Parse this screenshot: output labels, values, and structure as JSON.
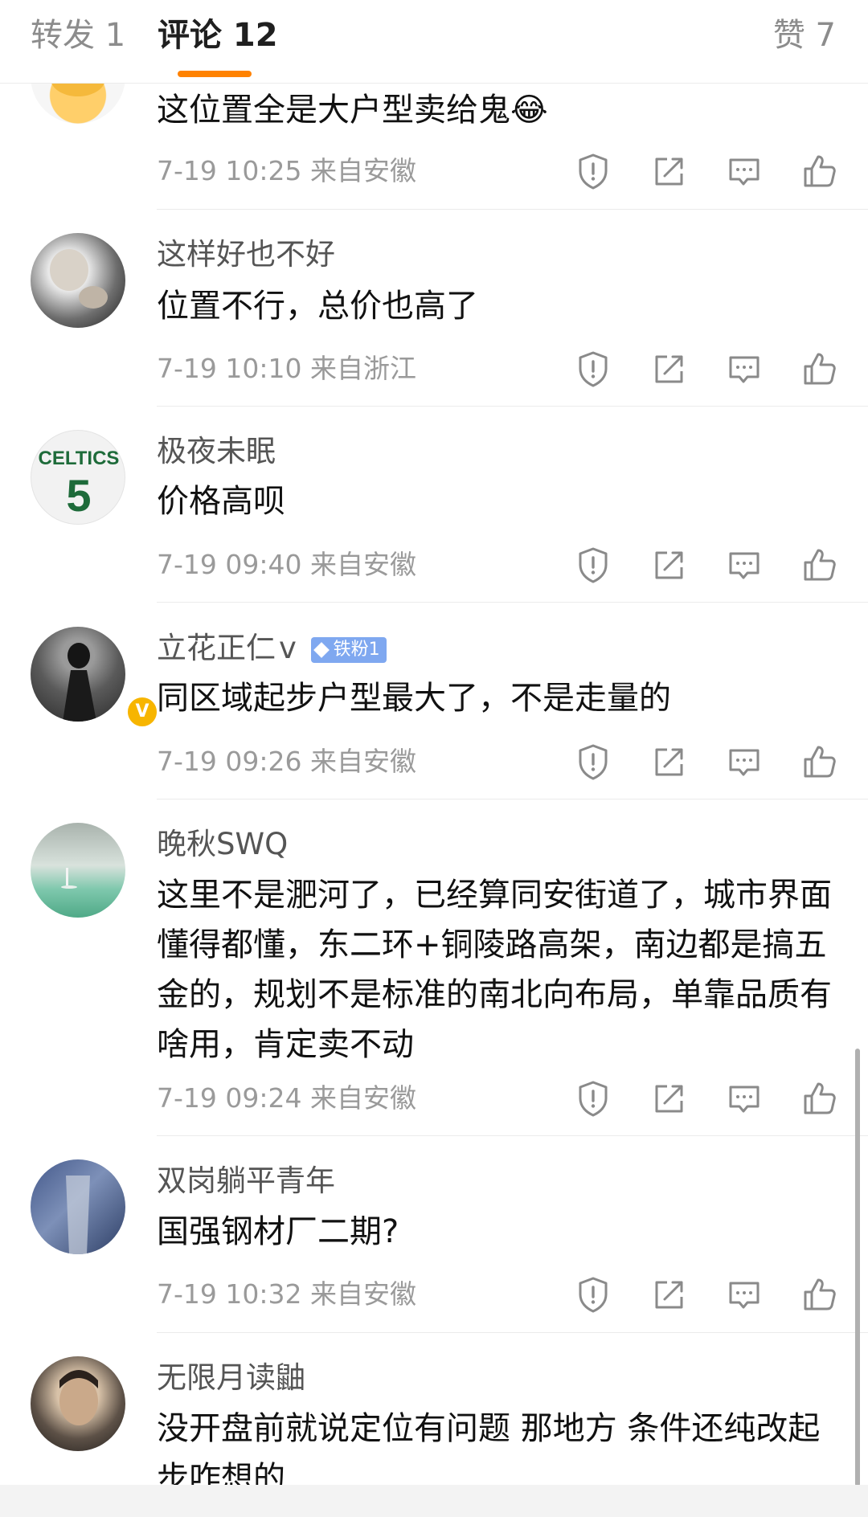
{
  "tabs": {
    "repost": "转发 1",
    "comments": "评论 12",
    "likes": "赞 7",
    "accent": "#ff8200"
  },
  "comments": [
    {
      "name": "",
      "text": "这位置全是大户型卖给鬼",
      "emoji": "😂",
      "meta": "7-19 10:25  来自安徽"
    },
    {
      "name": "这样好也不好",
      "text": "位置不行，总价也高了",
      "meta": "7-19 10:10  来自浙江"
    },
    {
      "name": "极夜未眠",
      "text": "价格高呗",
      "meta": "7-19 09:40  来自安徽",
      "avatar_text": "CELTICS",
      "avatar_number": "5"
    },
    {
      "name": "立花正仁",
      "name_suffix": "v",
      "fan_badge": "铁粉1",
      "verified": "V",
      "text": "同区域起步户型最大了，不是走量的",
      "meta": "7-19 09:26  来自安徽"
    },
    {
      "name": "晚秋SWQ",
      "text": "这里不是淝河了，已经算同安街道了，城市界面懂得都懂，东二环+铜陵路高架，南边都是搞五金的，规划不是标准的南北向布局，单靠品质有啥用，肯定卖不动",
      "meta": "7-19 09:24  来自安徽"
    },
    {
      "name": "双岗躺平青年",
      "text": "国强钢材厂二期?",
      "meta": "7-19 10:32  来自安徽"
    },
    {
      "name": "无限月读鼬",
      "text": "没开盘前就说定位有问题 那地方 条件还纯改起步咋想的",
      "meta": ""
    }
  ],
  "action_icons": [
    "report-icon",
    "share-icon",
    "reply-icon",
    "like-icon"
  ]
}
